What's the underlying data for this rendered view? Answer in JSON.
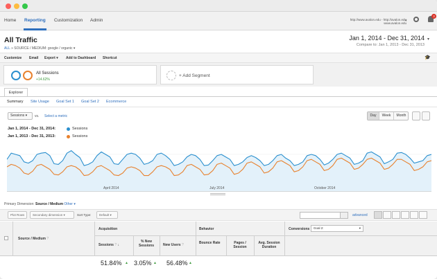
{
  "nav": {
    "tabs": [
      "Home",
      "Reporting",
      "Customization",
      "Admin"
    ],
    "account_line1": "http://www.avalon.edu - http://avalon.edu",
    "account_line2": "www.avalon.edu",
    "notification_count": "3"
  },
  "report": {
    "title": "All Traffic",
    "breadcrumb_root": "ALL",
    "breadcrumb_path": "» SOURCE / MEDIUM: google / organic",
    "date_range": "Jan 1, 2014 - Dec 31, 2014",
    "compare_range": "Compare to: Jan 1, 2013 - Dec 31, 2013"
  },
  "toolbar": {
    "customize": "Customize",
    "email": "Email",
    "export": "Export",
    "add_to_dashboard": "Add to Dashboard",
    "shortcut": "Shortcut"
  },
  "segments": {
    "name": "All Sessions",
    "pct": "+14.62%",
    "add_label": "+ Add Segment"
  },
  "explorer": {
    "tab": "Explorer",
    "subtabs": [
      "Summary",
      "Site Usage",
      "Goal Set 1",
      "Goal Set 2",
      "Ecommerce"
    ]
  },
  "chart_controls": {
    "metric": "Sessions",
    "vs": "vs.",
    "select_metric": "Select a metric",
    "periods": [
      "Day",
      "Week",
      "Month"
    ]
  },
  "colors": {
    "current": "#2a8fce",
    "previous": "#e8812d",
    "fill": "#e3f1fa"
  },
  "legend": {
    "current_period": "Jan 1, 2014 - Dec 31, 2014:",
    "previous_period": "Jan 1, 2013 - Dec 31, 2013:",
    "series_name": "Sessions"
  },
  "chart_data": {
    "type": "line",
    "x_tick_labels": [
      "April 2014",
      "July 2014",
      "October 2014"
    ],
    "series": [
      {
        "name": "Sessions",
        "period": "Jan 1, 2014 - Dec 31, 2014",
        "values": [
          52,
          62,
          60,
          58,
          48,
          46,
          50,
          60,
          62,
          63,
          58,
          45,
          44,
          50,
          62,
          66,
          60,
          55,
          42,
          44,
          48,
          58,
          64,
          60,
          56,
          45,
          44,
          52,
          60,
          62,
          60,
          54,
          44,
          46,
          50,
          60,
          62,
          58,
          52,
          42,
          44,
          48,
          56,
          60,
          58,
          52,
          42,
          43,
          50,
          58,
          60,
          56,
          52,
          42,
          44,
          48,
          55,
          58,
          55,
          50,
          42,
          44,
          50,
          58,
          60,
          54,
          50,
          42,
          44,
          48,
          58,
          60,
          58,
          52,
          43,
          46,
          52,
          60,
          62,
          58,
          54,
          44,
          46,
          50,
          62,
          64,
          60,
          56,
          45,
          48,
          52,
          62,
          63,
          60,
          54,
          46,
          48,
          50,
          58,
          60
        ]
      },
      {
        "name": "Sessions",
        "period": "Jan 1, 2013 - Dec 31, 2013",
        "values": [
          40,
          44,
          42,
          38,
          30,
          28,
          33,
          42,
          44,
          40,
          36,
          28,
          27,
          32,
          40,
          42,
          40,
          35,
          26,
          27,
          32,
          40,
          42,
          38,
          34,
          27,
          26,
          30,
          38,
          40,
          38,
          34,
          26,
          26,
          32,
          40,
          42,
          40,
          36,
          26,
          27,
          32,
          42,
          44,
          40,
          36,
          27,
          28,
          34,
          44,
          46,
          42,
          38,
          28,
          30,
          36,
          46,
          48,
          44,
          40,
          30,
          32,
          38,
          48,
          50,
          46,
          42,
          32,
          34,
          40,
          50,
          52,
          48,
          44,
          34,
          36,
          42,
          52,
          54,
          50,
          46,
          36,
          38,
          44,
          52,
          54,
          50,
          46,
          36,
          38,
          44,
          52,
          52,
          48,
          44,
          34,
          36,
          40,
          48,
          50
        ]
      }
    ]
  },
  "table": {
    "primary_dim_label": "Primary Dimension:",
    "primary_dim_value": "Source / Medium",
    "other": "Other",
    "plot_rows": "Plot Rows",
    "secondary_dimension": "Secondary dimension",
    "sort_type_label": "Sort Type:",
    "sort_type_value": "Default",
    "advanced": "advanced",
    "acquisition": "Acquisition",
    "behavior": "Behavior",
    "conversions": "Conversions",
    "goal": "Goal 2:",
    "col_source_medium": "Source / Medium",
    "col_sessions": "Sessions",
    "col_pct_new_sessions": "% New Sessions",
    "col_new_users": "New Users",
    "col_bounce_rate": "Bounce Rate",
    "col_pages_session": "Pages / Session",
    "col_avg_duration": "Avg. Session Duration",
    "totals": {
      "sessions": "51.84%",
      "pct_new": "3.05%",
      "new_users": "56.48%"
    }
  }
}
